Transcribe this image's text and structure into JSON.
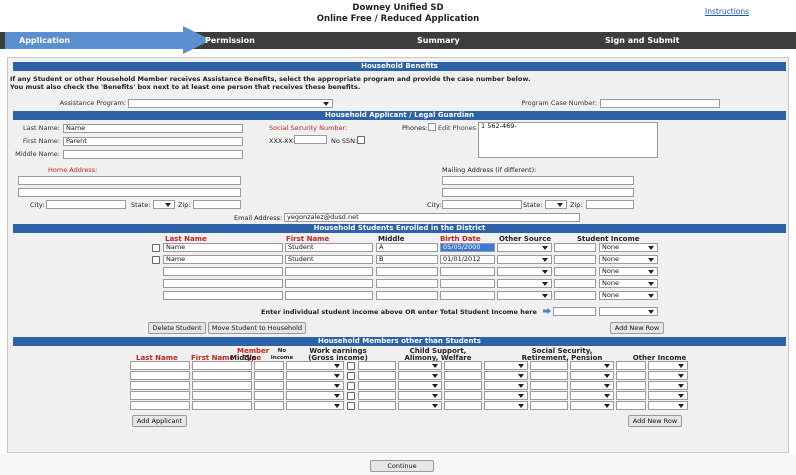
{
  "header": {
    "district": "Downey Unified SD",
    "app_title": "Online Free / Reduced Application",
    "instructions_link": "Instructions"
  },
  "steps": {
    "active": "Application",
    "permission": "Permission",
    "summary": "Summary",
    "sign_submit": "Sign and Submit"
  },
  "benefits": {
    "title": "Household Benefits",
    "note_line1": "If any Student or other Household Member receives Assistance Benefits, select the appropriate program and provide the case number below.",
    "note_line2": "You must also check the 'Benefits' box next to at least one person that receives these benefits.",
    "program_label": "Assistance Program:",
    "program_value": "",
    "case_label": "Program Case Number:",
    "case_value": ""
  },
  "applicant": {
    "title": "Household Applicant / Legal Guardian",
    "last_name_label": "Last Name:",
    "last_name": "Name",
    "first_name_label": "First Name:",
    "first_name": "Parent",
    "middle_name_label": "Middle Name:",
    "middle_name": "",
    "ssn_label": "Social Security Number:",
    "ssn_prefix": "XXX-XX-",
    "no_ssn_label": "No SSN:",
    "phones_label": "Phones:",
    "edit_phones_alt": "Edit Phones",
    "phone_line": "1         562-469-",
    "home_address_label": "Home Address:",
    "mailing_label": "Mailing Address (if different):",
    "city_label": "City:",
    "state_label": "State:",
    "zip_label": "Zip:",
    "email_label": "Email Address:",
    "email": "yegonzalez@dusd.net"
  },
  "students": {
    "title": "Household Students Enrolled in the District",
    "headers": {
      "last": "Last Name",
      "first": "First Name",
      "middle": "Middle",
      "birth": "Birth Date",
      "other_source": "Other Source",
      "income": "Student Income"
    },
    "rows": [
      {
        "last": "Name",
        "first": "Student",
        "middle": "A",
        "birth": "05/05/2000",
        "income": "None"
      },
      {
        "last": "Name",
        "first": "Student",
        "middle": "B",
        "birth": "01/01/2012",
        "income": "None"
      },
      {
        "last": "",
        "first": "",
        "middle": "",
        "birth": "",
        "income": "None"
      },
      {
        "last": "",
        "first": "",
        "middle": "",
        "birth": "",
        "income": "None"
      },
      {
        "last": "",
        "first": "",
        "middle": "",
        "birth": "",
        "income": "None"
      }
    ],
    "total_label": "Enter individual student income above OR enter Total Student Income here",
    "delete_btn": "Delete Student",
    "move_btn": "Move Student to Household",
    "add_row_btn": "Add New Row"
  },
  "members": {
    "title": "Household Members other than Students",
    "headers": {
      "last": "Last Name",
      "first": "First Name",
      "middle": "Middle",
      "member_type_1": "Member",
      "member_type_2": "Type",
      "no_income_1": "No",
      "no_income_2": "Income",
      "work_1": "Work earnings",
      "work_2": "(Gross income)",
      "child_1": "Child Support,",
      "child_2": "Alimony, Welfare",
      "social_1": "Social Security,",
      "social_2": "Retirement, Pension",
      "other": "Other Income"
    },
    "add_applicant_btn": "Add Applicant",
    "add_row_btn": "Add New Row"
  },
  "footer": {
    "continue_btn": "Continue"
  },
  "colors": {
    "section": "#2d62a8",
    "active_step": "#5b8fd0",
    "step_bar": "#3d3d3d",
    "required_label": "#c2261e"
  }
}
